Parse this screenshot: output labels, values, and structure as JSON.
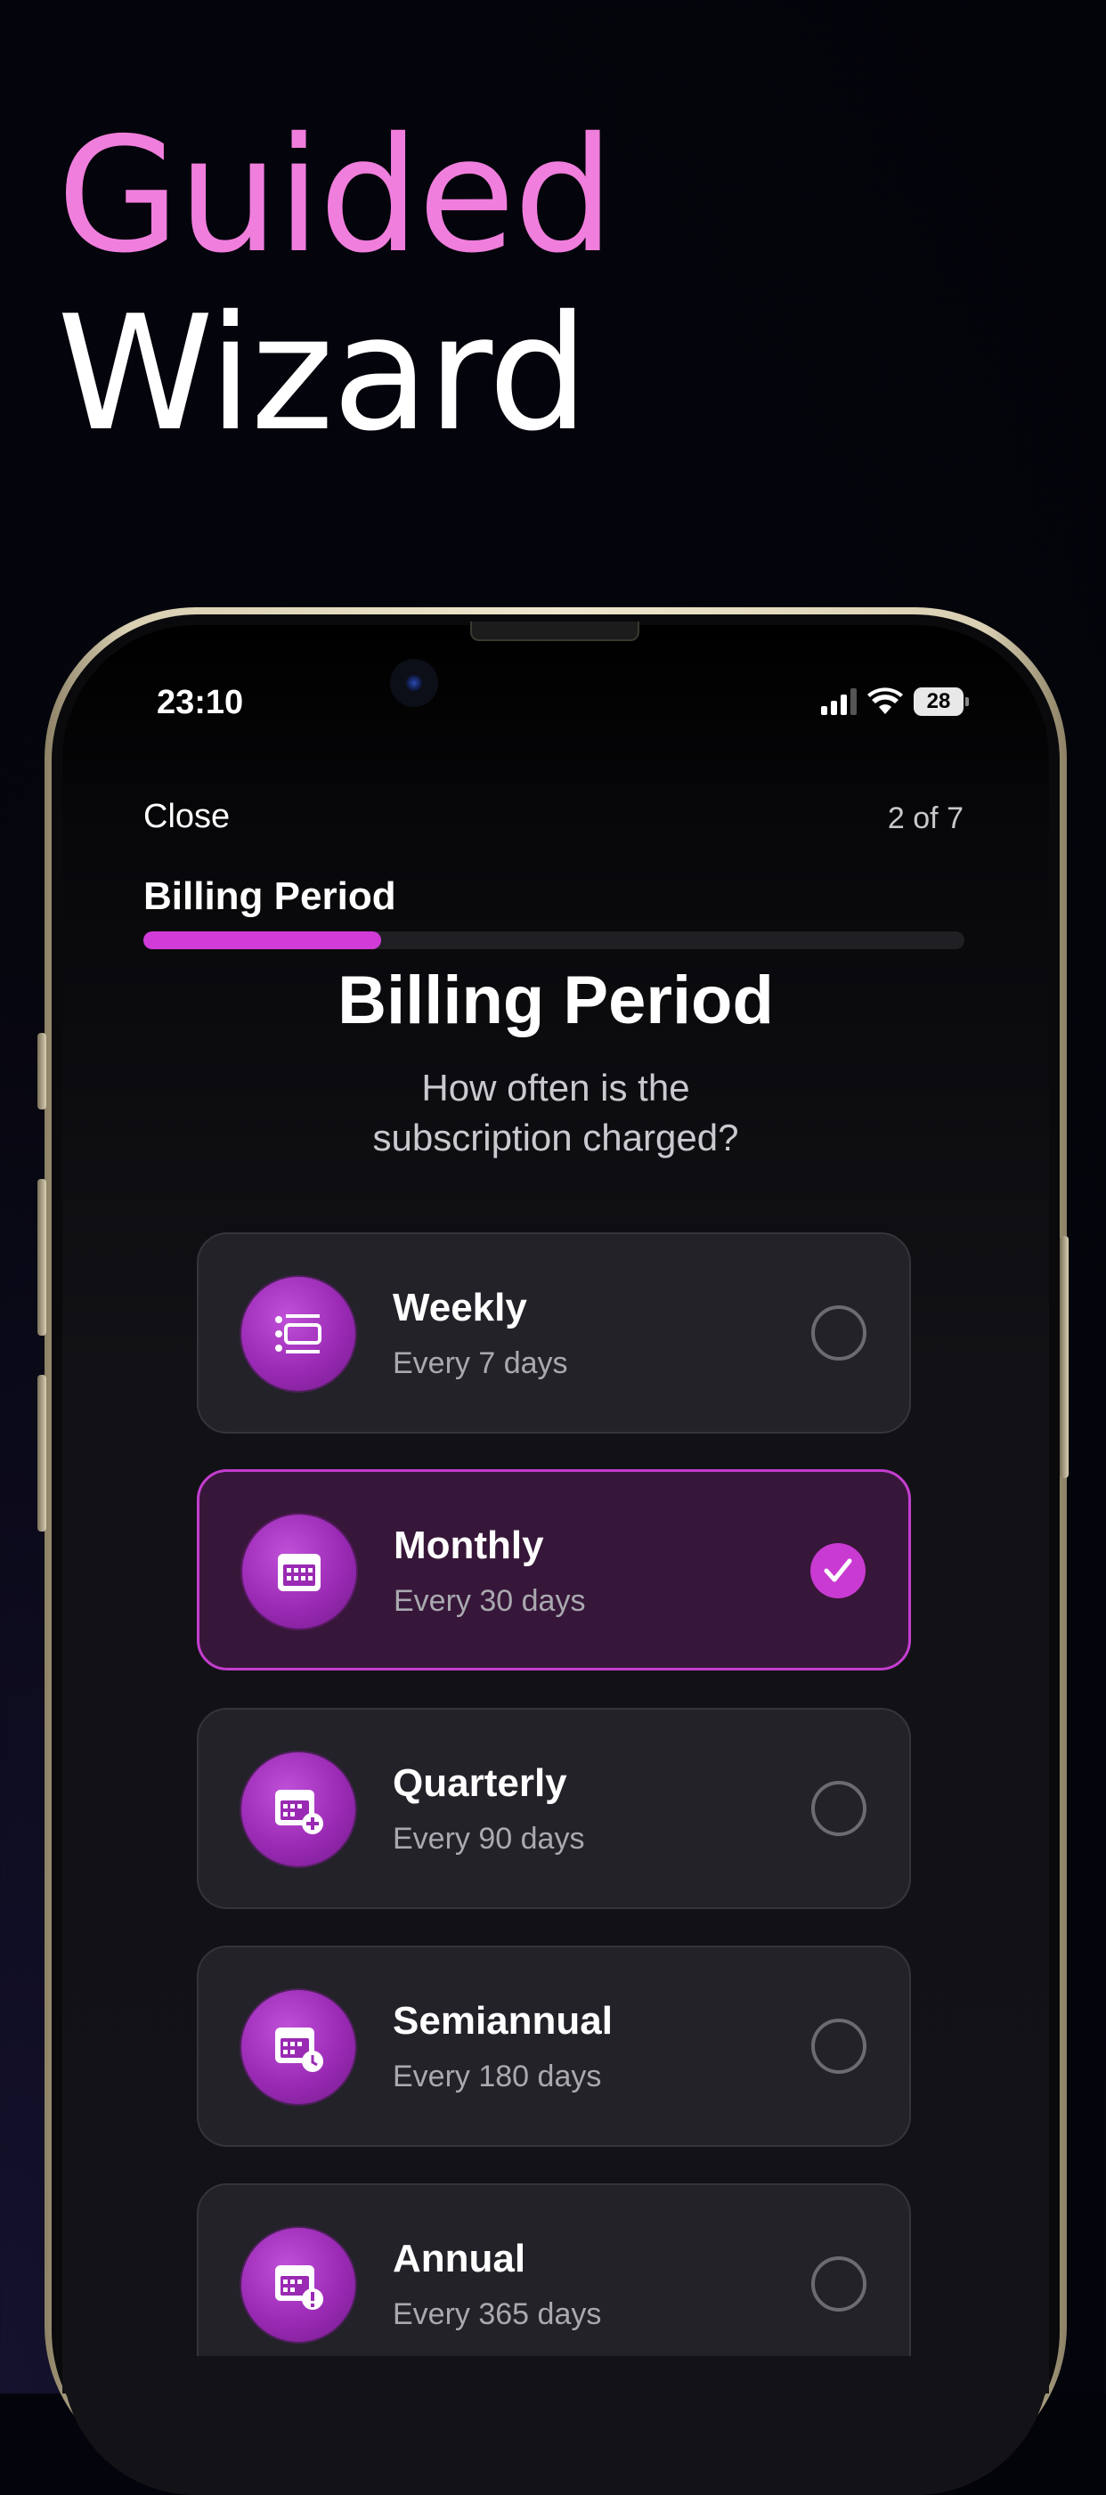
{
  "hero": {
    "line1": "Guided",
    "line2": "Wizard"
  },
  "status_bar": {
    "time": "23:10",
    "battery": "28"
  },
  "header": {
    "close_label": "Close",
    "step_counter": "2 of 7",
    "section_title": "Billing Period",
    "progress_fraction": 0.29
  },
  "main": {
    "title": "Billing Period",
    "subtitle_line1": "How often is the",
    "subtitle_line2": "subscription charged?"
  },
  "options": [
    {
      "label": "Weekly",
      "sub": "Every 7 days",
      "icon": "list-icon",
      "selected": false
    },
    {
      "label": "Monthly",
      "sub": "Every 30 days",
      "icon": "calendar-icon",
      "selected": true
    },
    {
      "label": "Quarterly",
      "sub": "Every 90 days",
      "icon": "calendar-plus-icon",
      "selected": false
    },
    {
      "label": "Semiannual",
      "sub": "Every 180 days",
      "icon": "calendar-clock-icon",
      "selected": false
    },
    {
      "label": "Annual",
      "sub": "Every 365 days",
      "icon": "calendar-alert-icon",
      "selected": false
    }
  ],
  "colors": {
    "accent": "#d13bd8",
    "hero_pink": "#f07edc",
    "background": "#05050d"
  }
}
